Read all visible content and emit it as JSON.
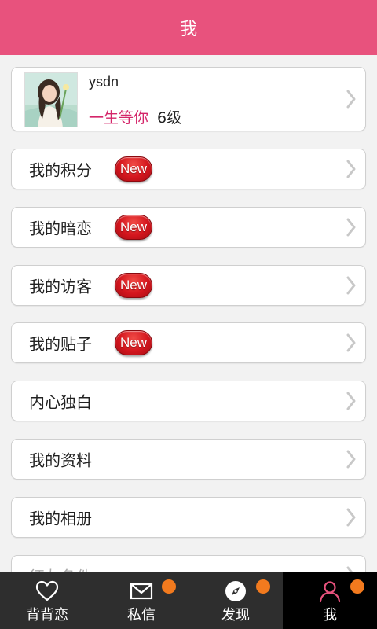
{
  "header": {
    "title": "我"
  },
  "profile": {
    "username": "ysdn",
    "motto": "一生等你",
    "level": "6级"
  },
  "menu": {
    "items": [
      {
        "label": "我的积分",
        "badge": "New"
      },
      {
        "label": "我的暗恋",
        "badge": "New"
      },
      {
        "label": "我的访客",
        "badge": "New"
      },
      {
        "label": "我的贴子",
        "badge": "New"
      },
      {
        "label": "内心独白"
      },
      {
        "label": "我的资料"
      },
      {
        "label": "我的相册"
      },
      {
        "label": "征友条件"
      }
    ]
  },
  "tabbar": {
    "tabs": [
      {
        "label": "背背恋",
        "icon": "heart-icon"
      },
      {
        "label": "私信",
        "icon": "mail-icon",
        "dot": true
      },
      {
        "label": "发现",
        "icon": "compass-icon",
        "dot": true
      },
      {
        "label": "我",
        "icon": "person-icon",
        "dot": true,
        "active": true
      }
    ]
  },
  "colors": {
    "accent": "#e8527d",
    "motto": "#d4266a",
    "badge": "#d4161e",
    "notify_dot": "#f27a1e",
    "tabbar": "#2e2e2e"
  }
}
